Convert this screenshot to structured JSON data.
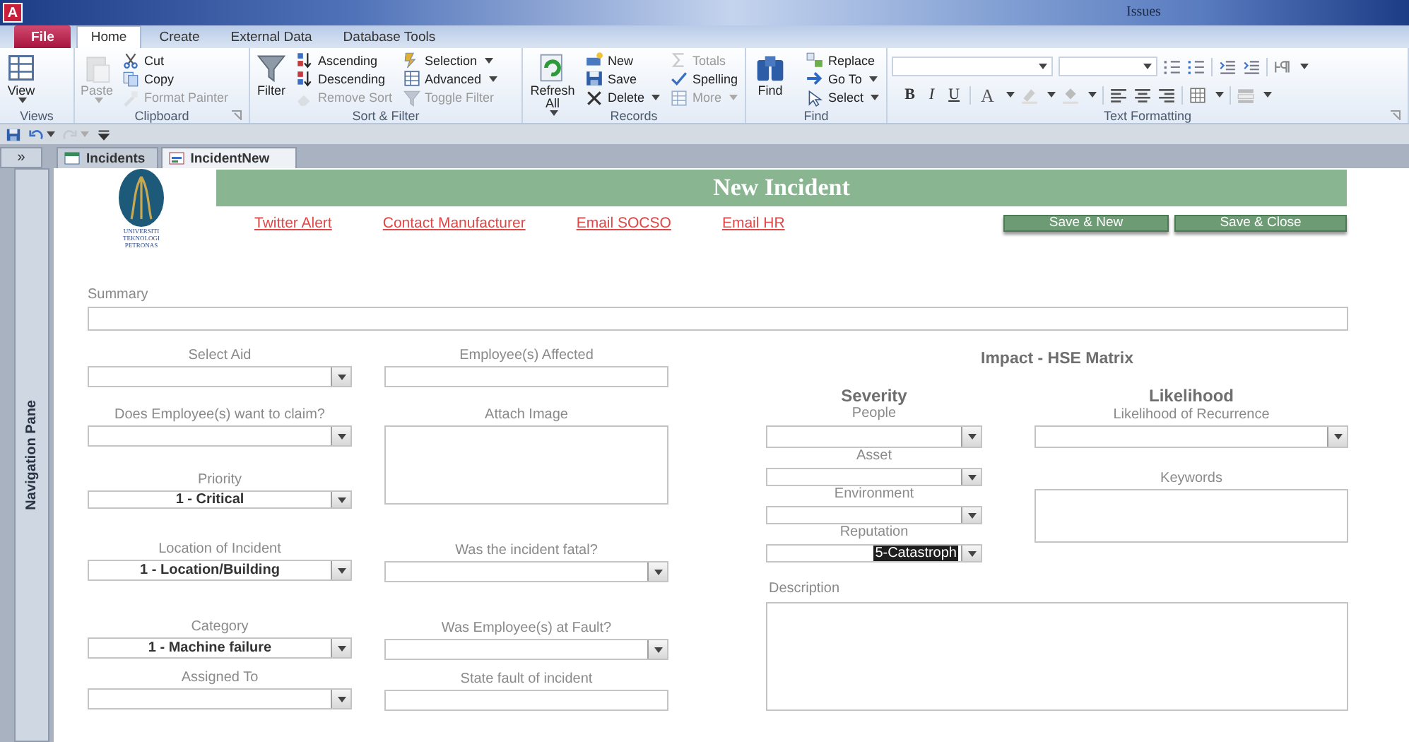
{
  "title_bar": {
    "app_icon": "A",
    "title": "Issues"
  },
  "ribbon_tabs": [
    {
      "label": "File",
      "kind": "file",
      "selected": false
    },
    {
      "label": "Home",
      "kind": "tab",
      "selected": true
    },
    {
      "label": "Create",
      "kind": "tab",
      "selected": false
    },
    {
      "label": "External Data",
      "kind": "tab",
      "selected": false
    },
    {
      "label": "Database Tools",
      "kind": "tab",
      "selected": false
    }
  ],
  "ribbon_groups": [
    {
      "label": "Views",
      "kind": "buttons",
      "launcher": false,
      "buttons": [
        {
          "label": "View",
          "kind": "large",
          "dropdown": true,
          "disabled": false
        }
      ]
    },
    {
      "label": "Clipboard",
      "kind": "buttons",
      "launcher": true,
      "buttons": [
        {
          "label": "Paste",
          "kind": "large",
          "dropdown": true,
          "disabled": true
        },
        {
          "label": "Cut",
          "kind": "small",
          "dropdown": false,
          "disabled": false
        },
        {
          "label": "Copy",
          "kind": "small",
          "dropdown": false,
          "disabled": false
        },
        {
          "label": "Format Painter",
          "kind": "small",
          "dropdown": false,
          "disabled": true
        }
      ]
    },
    {
      "label": "Sort & Filter",
      "kind": "buttons",
      "launcher": false,
      "buttons": [
        {
          "label": "Filter",
          "kind": "large",
          "dropdown": false,
          "disabled": false
        },
        {
          "label": "Ascending",
          "kind": "small",
          "dropdown": false,
          "disabled": false
        },
        {
          "label": "Descending",
          "kind": "small",
          "dropdown": false,
          "disabled": false
        },
        {
          "label": "Remove Sort",
          "kind": "small",
          "dropdown": false,
          "disabled": true
        },
        {
          "label": "Selection",
          "kind": "small",
          "dropdown": true,
          "disabled": false
        },
        {
          "label": "Advanced",
          "kind": "small",
          "dropdown": true,
          "disabled": false
        },
        {
          "label": "Toggle Filter",
          "kind": "small",
          "dropdown": false,
          "disabled": true
        }
      ]
    },
    {
      "label": "Records",
      "kind": "buttons",
      "launcher": false,
      "buttons": [
        {
          "label": "Refresh All",
          "kind": "large",
          "dropdown": true,
          "disabled": false
        },
        {
          "label": "New",
          "kind": "small",
          "dropdown": false,
          "disabled": false
        },
        {
          "label": "Save",
          "kind": "small",
          "dropdown": false,
          "disabled": false
        },
        {
          "label": "Delete",
          "kind": "small",
          "dropdown": true,
          "disabled": false
        },
        {
          "label": "Totals",
          "kind": "small",
          "dropdown": false,
          "disabled": true
        },
        {
          "label": "Spelling",
          "kind": "small",
          "dropdown": false,
          "disabled": false
        },
        {
          "label": "More",
          "kind": "small",
          "dropdown": true,
          "disabled": true
        }
      ]
    },
    {
      "label": "Find",
      "kind": "buttons",
      "launcher": false,
      "buttons": [
        {
          "label": "Find",
          "kind": "large",
          "dropdown": false,
          "disabled": false
        },
        {
          "label": "Replace",
          "kind": "small",
          "dropdown": false,
          "disabled": false
        },
        {
          "label": "Go To",
          "kind": "small",
          "dropdown": true,
          "disabled": false
        },
        {
          "label": "Select",
          "kind": "small",
          "dropdown": true,
          "disabled": false
        }
      ]
    },
    {
      "label": "Text Formatting",
      "kind": "format",
      "launcher": true,
      "letters": [
        {
          "text": "B",
          "kind": "bold"
        },
        {
          "text": "I",
          "kind": "italic"
        },
        {
          "text": "U",
          "kind": "underline"
        },
        {
          "text": "A",
          "kind": "font_color"
        }
      ]
    }
  ],
  "quick_access": [
    {
      "kind": "save",
      "disabled": false
    },
    {
      "kind": "undo",
      "disabled": false
    },
    {
      "kind": "redo",
      "disabled": true
    },
    {
      "kind": "customize",
      "disabled": false
    }
  ],
  "document_tabs": {
    "toggle": "»",
    "tabs": [
      {
        "label": "Incidents",
        "selected": false
      },
      {
        "label": "IncidentNew",
        "selected": true
      }
    ]
  },
  "navigation_pane": {
    "label": "Navigation Pane"
  },
  "form": {
    "logo_text": [
      "UNIVERSITI",
      "TEKNOLOGI",
      "PETRONAS"
    ],
    "title": "New Incident",
    "links": [
      "Twitter Alert",
      "Contact Manufacturer",
      "Email SOCSO",
      "Email HR"
    ],
    "buttons": [
      "Save & New",
      "Save & Close"
    ],
    "summary": {
      "label": "Summary"
    },
    "left_fields": [
      {
        "label": "Select Aid",
        "kind": "combo"
      },
      {
        "label": "Does Employee(s) want to claim?",
        "kind": "combo"
      },
      {
        "label": "Priority",
        "kind": "combo",
        "value": "1 - Critical"
      },
      {
        "label": "Location of Incident",
        "kind": "combo",
        "value": "1 - Location/Building"
      },
      {
        "label": "Category",
        "kind": "combo",
        "value": "1 - Machine failure"
      },
      {
        "label": "Assigned To",
        "kind": "combo"
      }
    ],
    "middle_fields": [
      {
        "label": "Employee(s) Affected",
        "kind": "text"
      },
      {
        "label": "Attach Image",
        "kind": "memo"
      },
      {
        "label": "Was the incident fatal?",
        "kind": "combo"
      },
      {
        "label": "Was Employee(s) at Fault?",
        "kind": "combo"
      },
      {
        "label": "State fault of incident",
        "kind": "text"
      }
    ],
    "matrix": {
      "title": "Impact - HSE Matrix",
      "severity": {
        "heading": "Severity",
        "fields": [
          {
            "label": "People",
            "kind": "combo"
          },
          {
            "label": "Asset",
            "kind": "combo"
          },
          {
            "label": "Environment",
            "kind": "combo"
          },
          {
            "label": "Reputation",
            "kind": "combo",
            "value": "5-Catastroph",
            "highlighted": true
          }
        ]
      },
      "likelihood": {
        "heading": "Likelihood",
        "fields": [
          {
            "label": "Likelihood of Recurrence",
            "kind": "combo"
          },
          {
            "label": "Keywords",
            "kind": "memo"
          }
        ]
      }
    },
    "description": {
      "label": "Description"
    }
  }
}
